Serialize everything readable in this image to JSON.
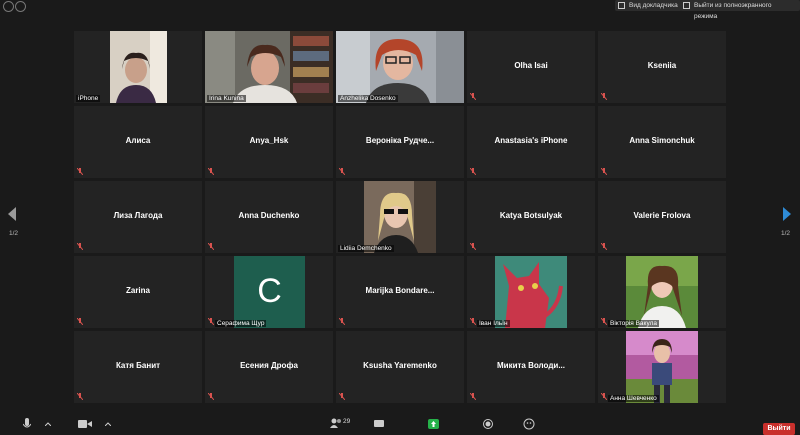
{
  "topbar": {
    "gallery_view_label": "Вид докладчика",
    "exit_fullscreen_label": "Выйти из полноэкранного режима"
  },
  "tiles": [
    {
      "name": "",
      "label": "iPhone"
    },
    {
      "name": "",
      "label": "Irina Kunina"
    },
    {
      "name": "",
      "label": "Anzhelika Dosenko"
    },
    {
      "name": "Olha Isai",
      "label": ""
    },
    {
      "name": "Kseniia",
      "label": ""
    },
    {
      "name": "Алиса",
      "label": ""
    },
    {
      "name": "Anya_Hsk",
      "label": ""
    },
    {
      "name": "Вероніка Рудче...",
      "label": ""
    },
    {
      "name": "Anastasia's iPhone",
      "label": ""
    },
    {
      "name": "Anna Simonchuk",
      "label": ""
    },
    {
      "name": "Лиза Лагода",
      "label": ""
    },
    {
      "name": "Anna Duchenko",
      "label": ""
    },
    {
      "name": "",
      "label": "Lidiia Demchenko"
    },
    {
      "name": "Katya Botsulyak",
      "label": ""
    },
    {
      "name": "Valerie Frolova",
      "label": ""
    },
    {
      "name": "Zarina",
      "label": ""
    },
    {
      "name": "",
      "label": "Серафима Щур",
      "avatar_letter": "C"
    },
    {
      "name": "Marijka  Bondare...",
      "label": ""
    },
    {
      "name": "",
      "label": "Іван Ільїн"
    },
    {
      "name": "",
      "label": "Вікторія Вакула"
    },
    {
      "name": "Катя Банит",
      "label": ""
    },
    {
      "name": "Есения Дрофа",
      "label": ""
    },
    {
      "name": "Ksusha Yaremenko",
      "label": ""
    },
    {
      "name": "Микита  Володи...",
      "label": ""
    },
    {
      "name": "",
      "label": "Анна Шевченко"
    }
  ],
  "pager": {
    "left": "1/2",
    "right": "1/2"
  },
  "bottombar": {
    "participants_count": "29",
    "leave_label": "Выйти"
  },
  "colors": {
    "active_speaker": "#d7df5b",
    "muted_icon": "#d9534f",
    "next_arrow": "#2e8bd6",
    "leave": "#c9302c"
  }
}
